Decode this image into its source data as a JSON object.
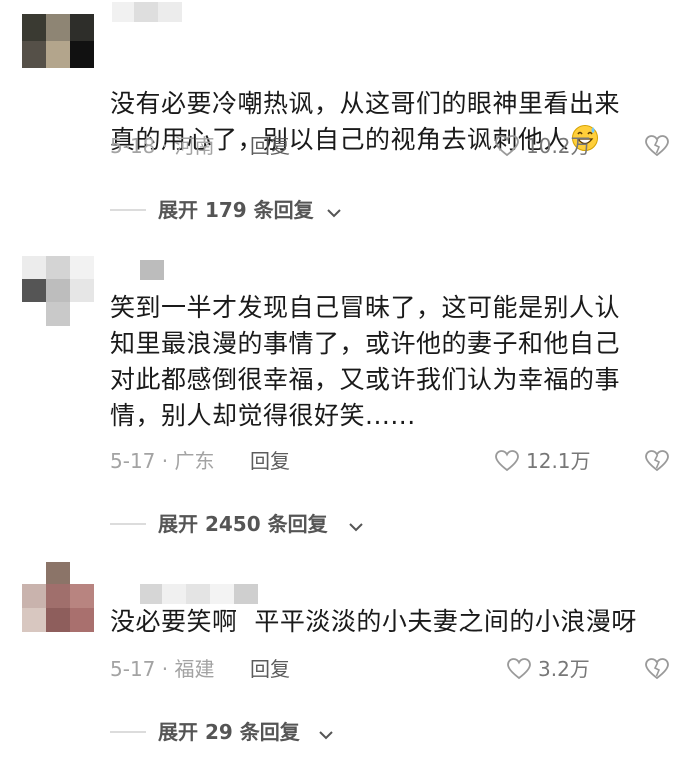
{
  "comments": [
    {
      "content": "没有必要冷嘲热讽，从这哥们的眼神里看出来\n真的用心了，别以自己的视角去讽刺他人",
      "emoji": "grinning-sweat-emoji",
      "date": "5-18",
      "location": "河南",
      "date_location": "5-18 · 河南",
      "reply_label": "回复",
      "likes": "10.2万",
      "expand_label": "展开 179 条回复"
    },
    {
      "content": "笑到一半才发现自己冒昧了，这可能是别人认\n知里最浪漫的事情了，或许他的妻子和他自己\n对此都感倒很幸福，又或许我们认为幸福的事\n情，别人却觉得很好笑......",
      "date": "5-17",
      "location": "广东",
      "date_location": "5-17 · 广东",
      "reply_label": "回复",
      "likes": "12.1万",
      "expand_label": "展开 2450 条回复"
    },
    {
      "content": "没必要笑啊  平平淡淡的小夫妻之间的小浪漫呀",
      "date": "5-17",
      "location": "福建",
      "date_location": "5-17 · 福建",
      "reply_label": "回复",
      "likes": "3.2万",
      "expand_label": "展开 29 条回复"
    }
  ],
  "icons": {
    "like": "heart-outline-icon",
    "dislike": "broken-heart-icon",
    "expand": "chevron-down-icon"
  },
  "colors": {
    "text": "#1a1a1a",
    "meta": "#a3a3a3",
    "reply": "#5c5c5c",
    "expand": "#555555",
    "divider": "#dcdcdc",
    "icon": "#9a9a9a"
  }
}
